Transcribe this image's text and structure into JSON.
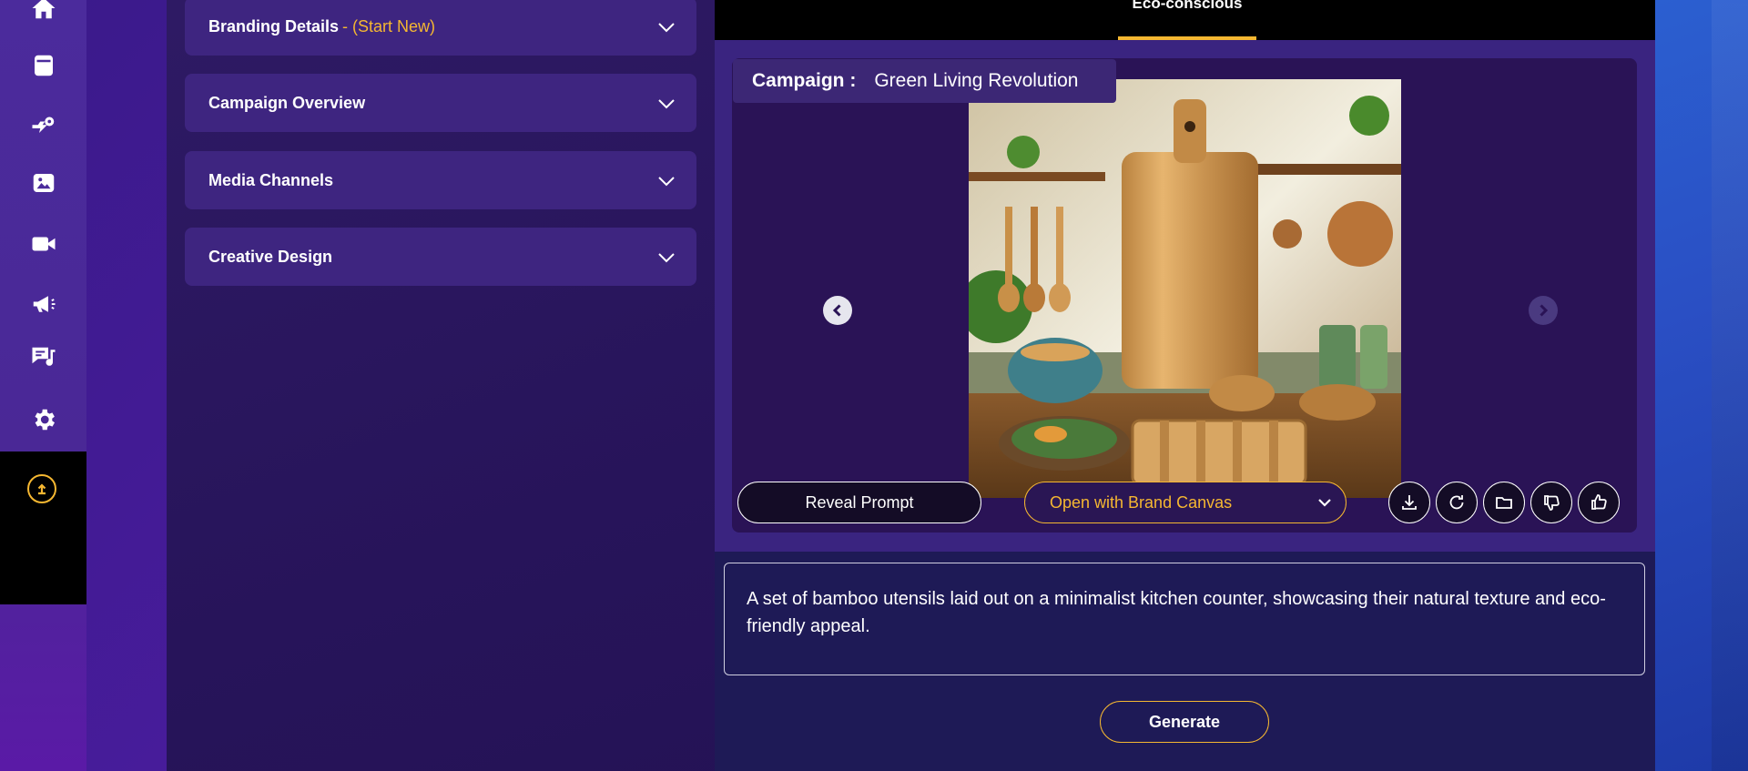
{
  "sidebar": {
    "items": [
      {
        "icon": "home-icon"
      },
      {
        "icon": "archive-icon"
      },
      {
        "icon": "automation-icon"
      },
      {
        "icon": "image-icon"
      },
      {
        "icon": "video-icon"
      },
      {
        "icon": "megaphone-icon"
      },
      {
        "icon": "chat-music-icon"
      },
      {
        "icon": "gear-icon"
      }
    ],
    "upload_icon": "upload-icon"
  },
  "accordions": [
    {
      "title": "Branding Details",
      "suffix": " - (Start New)"
    },
    {
      "title": "Campaign Overview",
      "suffix": ""
    },
    {
      "title": "Media Channels",
      "suffix": ""
    },
    {
      "title": "Creative Design",
      "suffix": ""
    }
  ],
  "tabs": {
    "active": "Eco-conscious"
  },
  "viewer": {
    "campaign_label": "Campaign :",
    "campaign_name": "Green Living Revolution",
    "reveal_prompt": "Reveal Prompt",
    "brand_canvas": "Open with Brand Canvas"
  },
  "prompt": {
    "text": "A set of bamboo utensils laid out on a minimalist kitchen counter, showcasing their natural texture and eco-friendly appeal."
  },
  "generate_label": "Generate",
  "colors": {
    "accent": "#f5b731",
    "panel": "#2e1a64",
    "accordion": "#3e2580"
  }
}
